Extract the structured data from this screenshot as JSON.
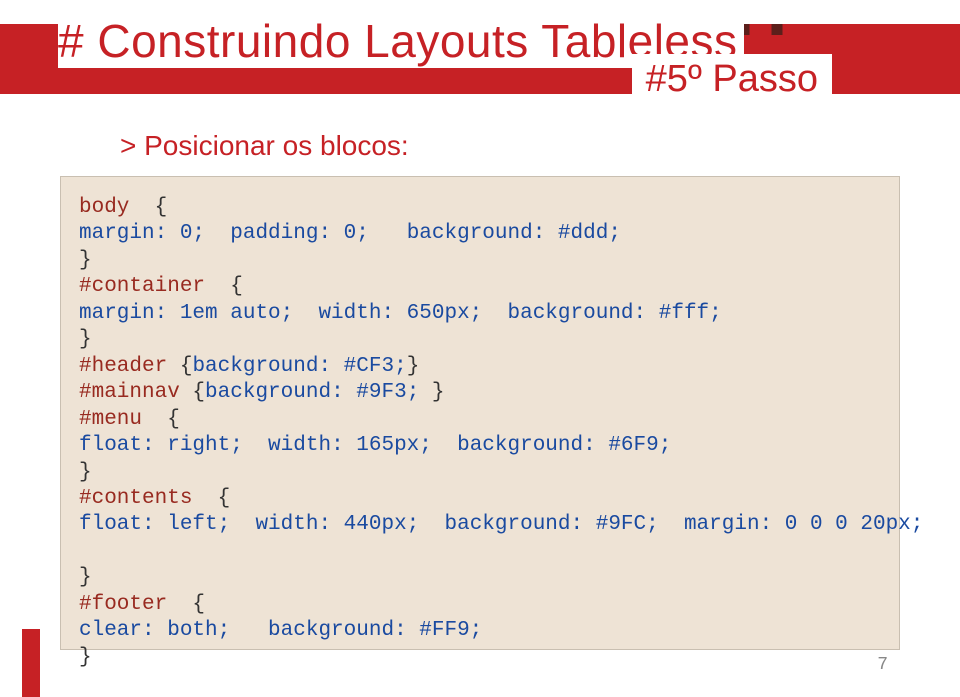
{
  "slide": {
    "title": "# Construindo Layouts Tableless",
    "step_badge": "#5º Passo",
    "heading": "> Posicionar os blocos:",
    "page_number": "7"
  },
  "code": {
    "l1_sel": "body",
    "l1_brace": "  {",
    "l2_p1": "margin",
    "l2_v1": ": 0;",
    "l2_p2": "  padding",
    "l2_v2": ": 0;",
    "l2_p3": "   background",
    "l2_v3": ": #ddd;",
    "l3": "}",
    "l4_sel": "#container",
    "l4_brace": "  {",
    "l5_p1": "margin",
    "l5_v1": ": 1em auto;",
    "l5_p2": "  width",
    "l5_v2": ": 650px;",
    "l5_p3": "  background",
    "l5_v3": ": #fff;",
    "l6": "}",
    "l7_sel": "#header",
    "l7_rest": " {",
    "l7_p": "background",
    "l7_v": ": #CF3;",
    "l7_end": "}",
    "l8_sel": "#mainnav",
    "l8_rest": " {",
    "l8_p": "background",
    "l8_v": ": #9F3;",
    "l8_end": " }",
    "l9_sel": "#menu",
    "l9_brace": "  {",
    "l10_p1": "float",
    "l10_v1": ": right;",
    "l10_p2": "  width",
    "l10_v2": ": 165px;",
    "l10_p3": "  background",
    "l10_v3": ": #6F9;",
    "l11": "}",
    "l12_sel": "#contents",
    "l12_brace": "  {",
    "l13_p1": "float",
    "l13_v1": ": left;",
    "l13_p2": "  width",
    "l13_v2": ": 440px;",
    "l13_p3": "  background",
    "l13_v3": ": #9FC;",
    "l13_p4": "  margin",
    "l13_v4": ": 0 0 0 20px;",
    "l14_blank": " ",
    "l15": "}",
    "l16_sel": "#footer",
    "l16_brace": "  {",
    "l17_p1": "clear",
    "l17_v1": ": both;",
    "l17_p2": "   background",
    "l17_v2": ": #FF9;",
    "l18": "}"
  }
}
